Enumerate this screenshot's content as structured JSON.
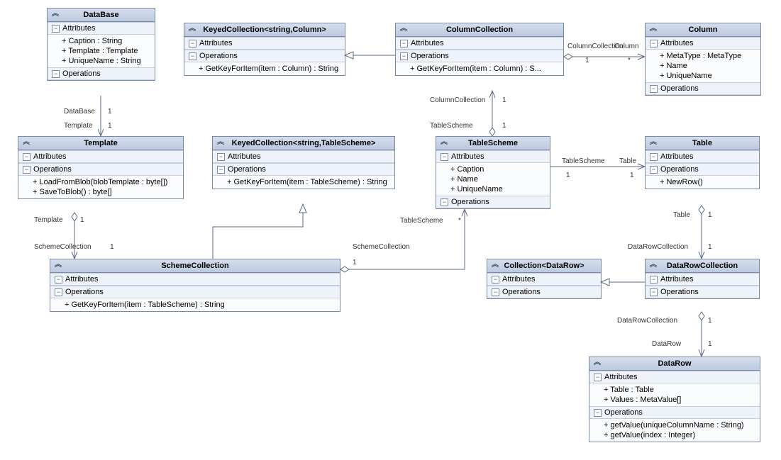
{
  "classes": {
    "database": {
      "title": "DataBase",
      "attrs_label": "Attributes",
      "ops_label": "Operations",
      "attrs": [
        "+ Caption : String",
        "+ Template : Template",
        "+ UniqueName : String"
      ]
    },
    "keyed_col_column": {
      "title": "KeyedCollection<string,Column>",
      "attrs_label": "Attributes",
      "ops_label": "Operations",
      "ops": [
        "+ GetKeyForItem(item : Column) : String"
      ]
    },
    "column_collection": {
      "title": "ColumnCollection",
      "attrs_label": "Attributes",
      "ops_label": "Operations",
      "ops": [
        "+ GetKeyForItem(item : Column) : S..."
      ]
    },
    "column": {
      "title": "Column",
      "attrs_label": "Attributes",
      "ops_label": "Operations",
      "attrs": [
        "+ MetaType : MetaType",
        "+ Name",
        "+ UniqueName"
      ]
    },
    "template": {
      "title": "Template",
      "attrs_label": "Attributes",
      "ops_label": "Operations",
      "ops": [
        "+ LoadFromBlob(blobTemplate : byte[])",
        "+ SaveToBlob() : byte[]"
      ]
    },
    "keyed_col_tablescheme": {
      "title": "KeyedCollection<string,TableScheme>",
      "attrs_label": "Attributes",
      "ops_label": "Operations",
      "ops": [
        "+ GetKeyForItem(item : TableScheme) : String"
      ]
    },
    "tablescheme": {
      "title": "TableScheme",
      "attrs_label": "Attributes",
      "ops_label": "Operations",
      "attrs": [
        "+ Caption",
        "+ Name",
        "+ UniqueName"
      ]
    },
    "table": {
      "title": "Table",
      "attrs_label": "Attributes",
      "ops_label": "Operations",
      "ops": [
        "+ NewRow()"
      ]
    },
    "scheme_collection": {
      "title": "SchemeCollection",
      "attrs_label": "Attributes",
      "ops_label": "Operations",
      "ops": [
        "+ GetKeyForItem(item : TableScheme) : String"
      ]
    },
    "collection_datarow": {
      "title": "Collection<DataRow>",
      "attrs_label": "Attributes",
      "ops_label": "Operations"
    },
    "datarow_collection": {
      "title": "DataRowCollection",
      "attrs_label": "Attributes",
      "ops_label": "Operations"
    },
    "datarow": {
      "title": "DataRow",
      "attrs_label": "Attributes",
      "ops_label": "Operations",
      "attrs": [
        "+ Table : Table",
        "+ Values : MetaValue[]"
      ],
      "ops": [
        "+ getValue(uniqueColumnName : String)",
        "+ getValue(index : Integer)"
      ]
    }
  },
  "labels": {
    "db_database": "DataBase",
    "db_template": "Template",
    "db_1a": "1",
    "db_1b": "1",
    "tmpl_template": "Template",
    "tmpl_scheme": "SchemeCollection",
    "tmpl_1a": "1",
    "tmpl_1b": "1",
    "sc_scheme": "SchemeCollection",
    "sc_ts": "TableScheme",
    "sc_1": "1",
    "sc_star": "*",
    "cc_columncol": "ColumnCollection",
    "cc_tablescheme": "TableScheme",
    "cc_1a": "1",
    "cc_1b": "1",
    "cc_column": "Column",
    "cc_colcol2": "ColumnCollection",
    "cc_col1": "1",
    "cc_colstar": "*",
    "ts_tablescheme": "TableScheme",
    "ts_table": "Table",
    "ts_1a": "1",
    "ts_1b": "1",
    "tbl_table": "Table",
    "tbl_drc": "DataRowCollection",
    "tbl_1a": "1",
    "tbl_1b": "1",
    "drc_drc": "DataRowCollection",
    "drc_dr": "DataRow",
    "drc_1a": "1",
    "drc_1b": "1"
  }
}
